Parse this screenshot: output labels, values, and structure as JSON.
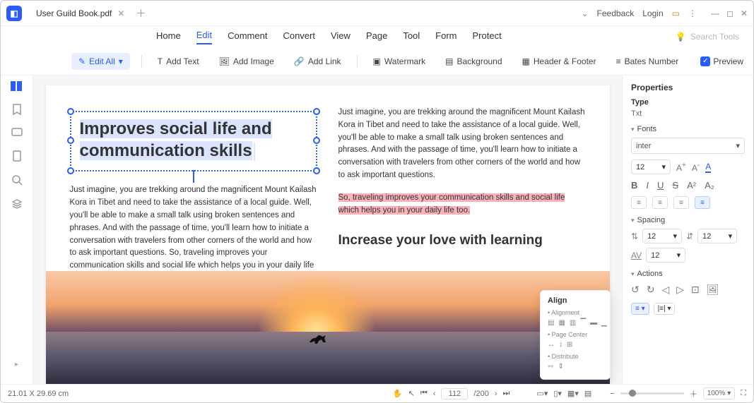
{
  "titlebar": {
    "filename": "User Guild Book.pdf",
    "feedback": "Feedback",
    "login": "Login"
  },
  "menu": {
    "home": "Home",
    "edit": "Edit",
    "comment": "Comment",
    "convert": "Convert",
    "view": "View",
    "page": "Page",
    "tool": "Tool",
    "form": "Form",
    "protect": "Protect",
    "search_placeholder": "Search Tools"
  },
  "toolbar": {
    "edit_all": "Edit All",
    "add_text": "Add Text",
    "add_image": "Add Image",
    "add_link": "Add Link",
    "watermark": "Watermark",
    "background": "Background",
    "header_footer": "Header & Footer",
    "bates": "Bates Number",
    "preview": "Preview"
  },
  "document": {
    "heading": "Improves social life and communication skills",
    "para_left": "Just imagine, you are trekking around the magnificent Mount Kailash Kora in Tibet and need to take the assistance of a local guide. Well, you'll be able to make a small talk using broken sentences and phrases. And with the passage of time, you'll learn how to initiate a conversation with travelers from other corners of the world and how to ask important questions. So, traveling improves your communication skills and social life which helps you in your daily life too.",
    "para_right_1": "Just imagine, you are trekking around the magnificent Mount Kailash Kora in Tibet and need to take the assistance of a local guide. Well, you'll be able to make a small talk using broken sentences and phrases. And with the passage of time, you'll learn how to initiate a conversation with travelers from other corners of the world and how to ask important questions.",
    "para_right_hl": "So, traveling improves your communication skills and social life which helps you in your daily life too.",
    "sub_heading": "Increase your love with learning"
  },
  "align_popup": {
    "title": "Align",
    "alignment": "Alignment",
    "page_center": "Page Center",
    "distribute": "Distribute"
  },
  "properties": {
    "title": "Properties",
    "type_label": "Type",
    "type_value": "Txt",
    "fonts_label": "Fonts",
    "font_name": "inter",
    "font_size": "12",
    "spacing_label": "Spacing",
    "spacing_v1": "12",
    "spacing_v2": "12",
    "spacing_v3": "12",
    "actions_label": "Actions"
  },
  "status": {
    "coords": "21.01 X 29.69 cm",
    "page_current": "112",
    "page_total": "/200",
    "zoom": "100%"
  }
}
